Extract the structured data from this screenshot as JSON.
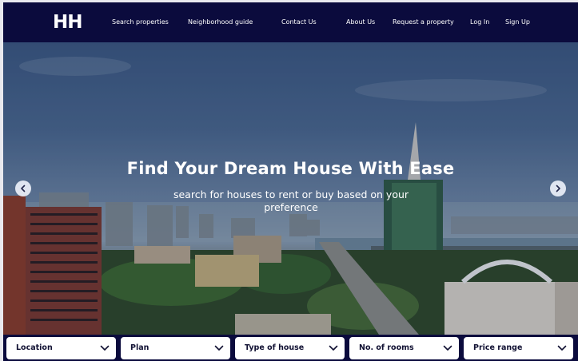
{
  "brand": {
    "logo_text": "HH"
  },
  "nav": {
    "items": [
      {
        "label": "Search properties"
      },
      {
        "label": "Neighborhood guide"
      },
      {
        "label": "Contact Us"
      },
      {
        "label": "About Us"
      },
      {
        "label": "Request a property"
      },
      {
        "label": "Log In"
      },
      {
        "label": "Sign Up"
      }
    ]
  },
  "hero": {
    "title": "Find Your Dream House With Ease",
    "subtitle": "search for houses to rent or buy based on your preference",
    "prev_icon": "chevron-left-icon",
    "next_icon": "chevron-right-icon"
  },
  "filters": [
    {
      "label": "Location",
      "icon": "chevron-down-icon"
    },
    {
      "label": "Plan",
      "icon": "chevron-down-icon"
    },
    {
      "label": "Type of house",
      "icon": "chevron-down-icon"
    },
    {
      "label": "No. of rooms",
      "icon": "chevron-down-icon"
    },
    {
      "label": "Price range",
      "icon": "chevron-down-icon"
    }
  ],
  "colors": {
    "navy": "#0b0b3d",
    "white": "#ffffff"
  }
}
